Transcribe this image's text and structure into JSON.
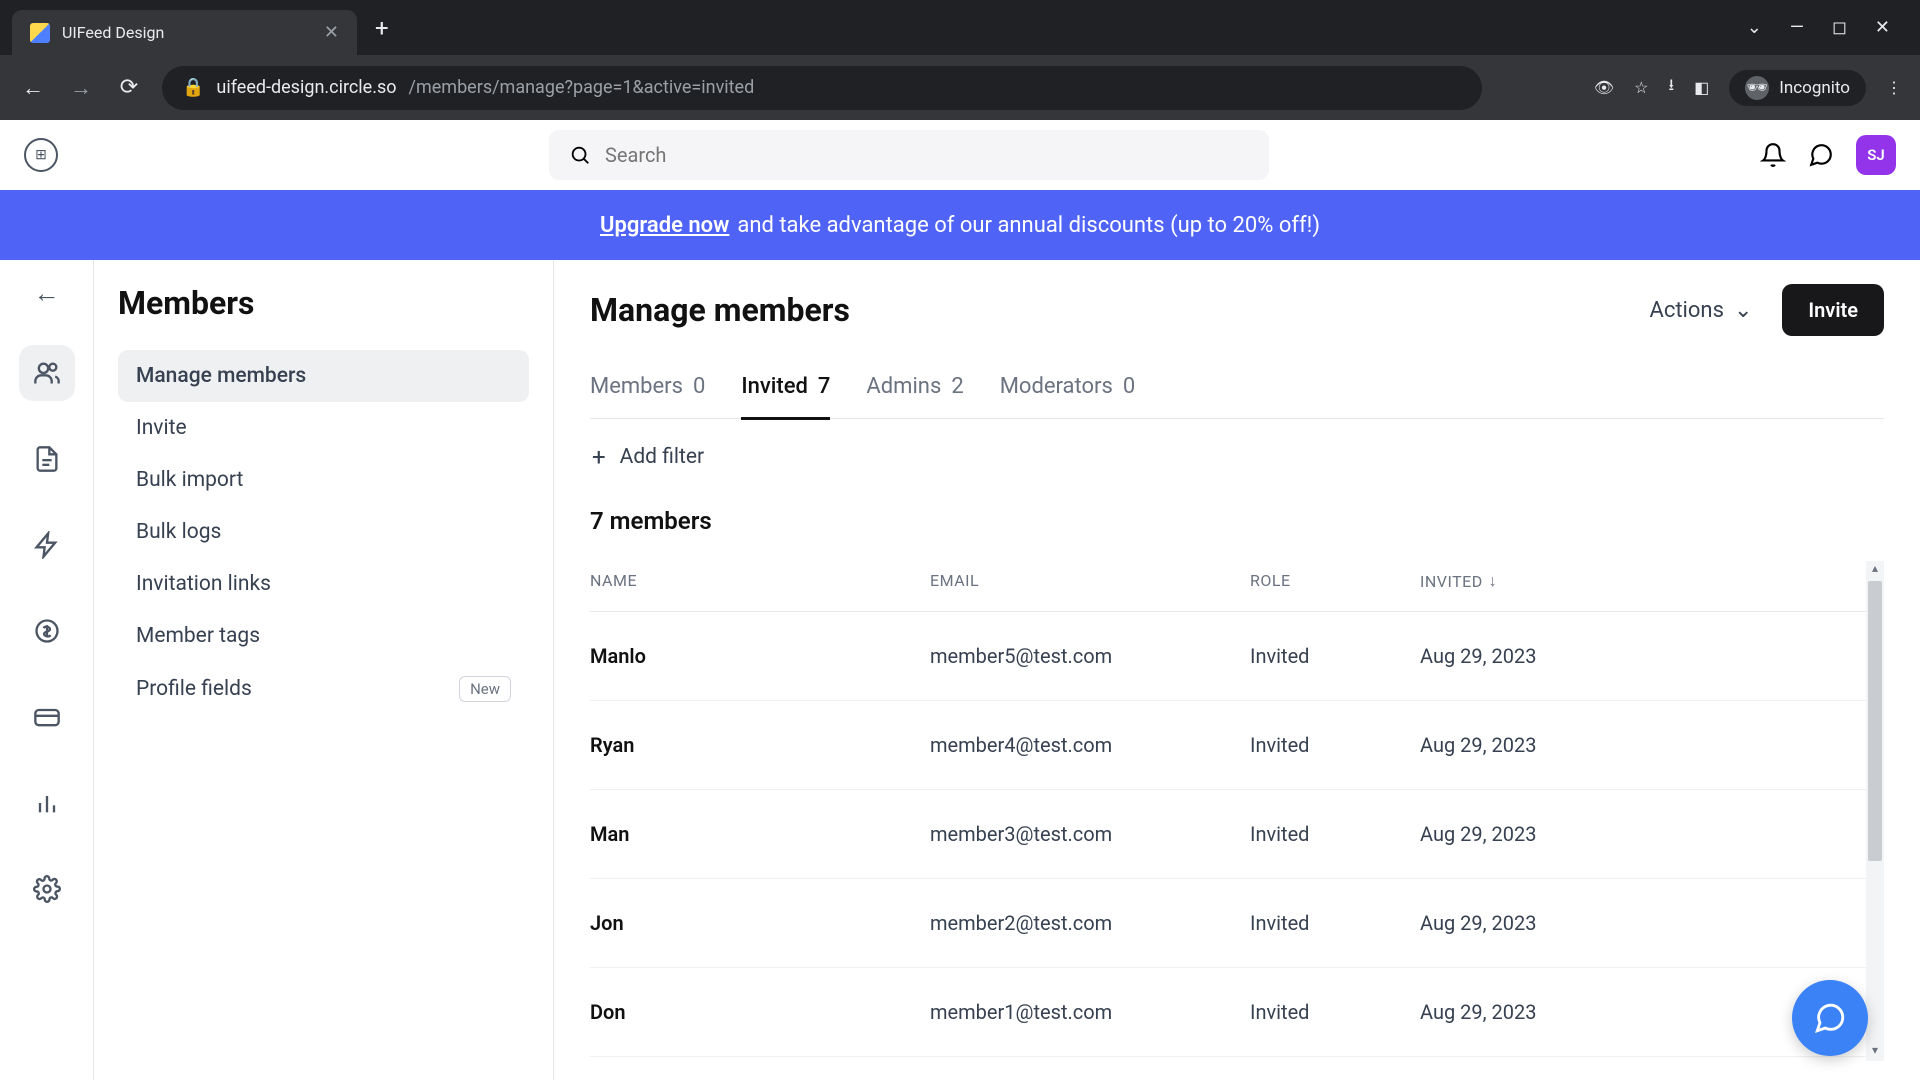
{
  "browser": {
    "tab_title": "UIFeed Design",
    "url_domain": "uifeed-design.circle.so",
    "url_path": "/members/manage?page=1&active=invited",
    "incognito_label": "Incognito"
  },
  "header": {
    "search_placeholder": "Search",
    "avatar_initials": "SJ"
  },
  "banner": {
    "link_text": "Upgrade now",
    "rest_text": " and take advantage of our annual discounts (up to 20% off!)"
  },
  "sidebar": {
    "title": "Members",
    "items": [
      {
        "label": "Manage members",
        "active": true
      },
      {
        "label": "Invite"
      },
      {
        "label": "Bulk import"
      },
      {
        "label": "Bulk logs"
      },
      {
        "label": "Invitation links"
      },
      {
        "label": "Member tags"
      },
      {
        "label": "Profile fields",
        "badge": "New"
      }
    ]
  },
  "main": {
    "title": "Manage members",
    "actions_label": "Actions",
    "invite_label": "Invite",
    "tabs": [
      {
        "label": "Members",
        "count": "0"
      },
      {
        "label": "Invited",
        "count": "7",
        "active": true
      },
      {
        "label": "Admins",
        "count": "2"
      },
      {
        "label": "Moderators",
        "count": "0"
      }
    ],
    "add_filter_label": "Add filter",
    "count_label": "7 members",
    "columns": {
      "name": "NAME",
      "email": "EMAIL",
      "role": "ROLE",
      "invited": "INVITED"
    },
    "rows": [
      {
        "name": "Manlo",
        "email": "member5@test.com",
        "role": "Invited",
        "invited": "Aug 29, 2023"
      },
      {
        "name": "Ryan",
        "email": "member4@test.com",
        "role": "Invited",
        "invited": "Aug 29, 2023"
      },
      {
        "name": "Man",
        "email": "member3@test.com",
        "role": "Invited",
        "invited": "Aug 29, 2023"
      },
      {
        "name": "Jon",
        "email": "member2@test.com",
        "role": "Invited",
        "invited": "Aug 29, 2023"
      },
      {
        "name": "Don",
        "email": "member1@test.com",
        "role": "Invited",
        "invited": "Aug 29, 2023"
      }
    ]
  }
}
